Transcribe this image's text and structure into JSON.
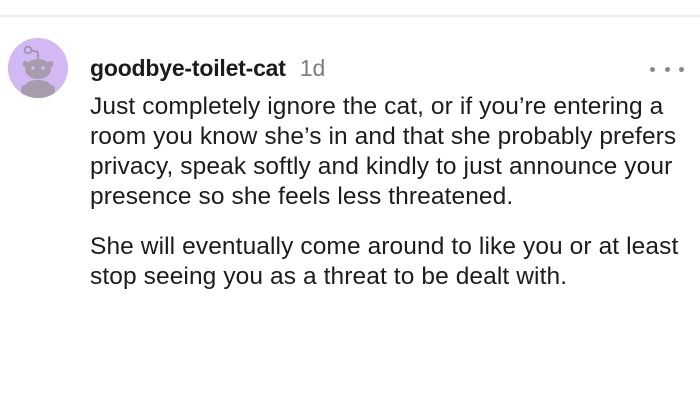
{
  "comment": {
    "avatar_icon": "reddit-snoo-avatar-icon",
    "avatar_color": "#d3b9f3",
    "username": "goodbye-toilet-cat",
    "timestamp": "1d",
    "more_icon": "ellipsis-icon",
    "paragraphs": [
      "Just completely ignore the cat, or if you’re entering a room you know she’s in and that she probably prefers privacy, speak softly and kindly to just announce your presence so she feels less threatened.",
      "She will eventually come around to like you or at least stop seeing you as a threat to be dealt with."
    ]
  }
}
